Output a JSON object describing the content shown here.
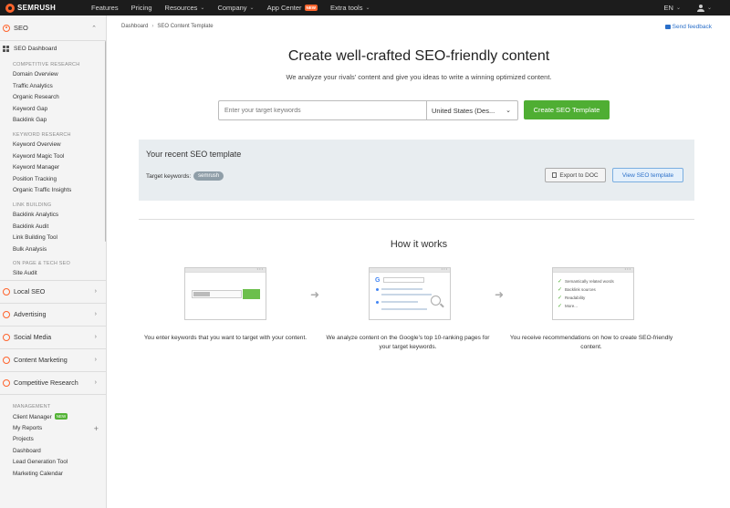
{
  "topnav": {
    "brand": "SEMRUSH",
    "items": [
      {
        "label": "Features",
        "dropdown": false
      },
      {
        "label": "Pricing",
        "dropdown": false
      },
      {
        "label": "Resources",
        "dropdown": true
      },
      {
        "label": "Company",
        "dropdown": true
      },
      {
        "label": "App Center",
        "dropdown": false
      },
      {
        "label": "Extra tools",
        "dropdown": true
      }
    ],
    "app_center_badge": "NEW",
    "language": "EN",
    "icons": {
      "user": "user-icon",
      "chevron": "chevron-down-icon"
    }
  },
  "sidebar": {
    "main_label": "SEO",
    "dashboard_label": "SEO Dashboard",
    "sections": [
      {
        "title": "COMPETITIVE RESEARCH",
        "items": [
          "Domain Overview",
          "Traffic Analytics",
          "Organic Research",
          "Keyword Gap",
          "Backlink Gap"
        ]
      },
      {
        "title": "KEYWORD RESEARCH",
        "items": [
          "Keyword Overview",
          "Keyword Magic Tool",
          "Keyword Manager",
          "Position Tracking",
          "Organic Traffic Insights"
        ]
      },
      {
        "title": "LINK BUILDING",
        "items": [
          "Backlink Analytics",
          "Backlink Audit",
          "Link Building Tool",
          "Bulk Analysis"
        ]
      },
      {
        "title": "ON PAGE & TECH SEO",
        "items": [
          "Site Audit"
        ]
      }
    ],
    "categories": [
      "Local SEO",
      "Advertising",
      "Social Media",
      "Content Marketing",
      "Competitive Research"
    ],
    "management": {
      "title": "MANAGEMENT",
      "client_manager": "Client Manager",
      "client_manager_badge": "NEW",
      "my_reports": "My Reports",
      "items": [
        "Projects",
        "Dashboard",
        "Lead Generation Tool",
        "Marketing Calendar"
      ]
    }
  },
  "breadcrumb": {
    "root": "Dashboard",
    "current": "SEO Content Template"
  },
  "feedback": "Send feedback",
  "hero": {
    "title": "Create well-crafted SEO-friendly content",
    "subtitle": "We analyze your rivals' content and give you ideas to write a winning optimized content."
  },
  "search": {
    "placeholder": "Enter your target keywords",
    "country": "United States (Des...",
    "button": "Create SEO Template"
  },
  "recent": {
    "title": "Your recent SEO template",
    "keywords_label": "Target keywords:",
    "keyword": "semrush",
    "export_label": "Export to DOC",
    "view_label": "View SEO template"
  },
  "how": {
    "title": "How it works",
    "steps": [
      "You enter keywords that you want to target with your content.",
      "We analyze content on the Google's top 10-ranking pages for your target keywords.",
      "You receive recommendations on how to create SEO-friendly content."
    ],
    "card3_items": [
      "Semantically related words",
      "Backlink sources",
      "Readability",
      "More..."
    ],
    "card2_logo": "G"
  },
  "colors": {
    "accent": "#4fae33",
    "brand": "#ff642d",
    "link": "#2a6fc9",
    "nav_bg": "#1c1c1c"
  }
}
